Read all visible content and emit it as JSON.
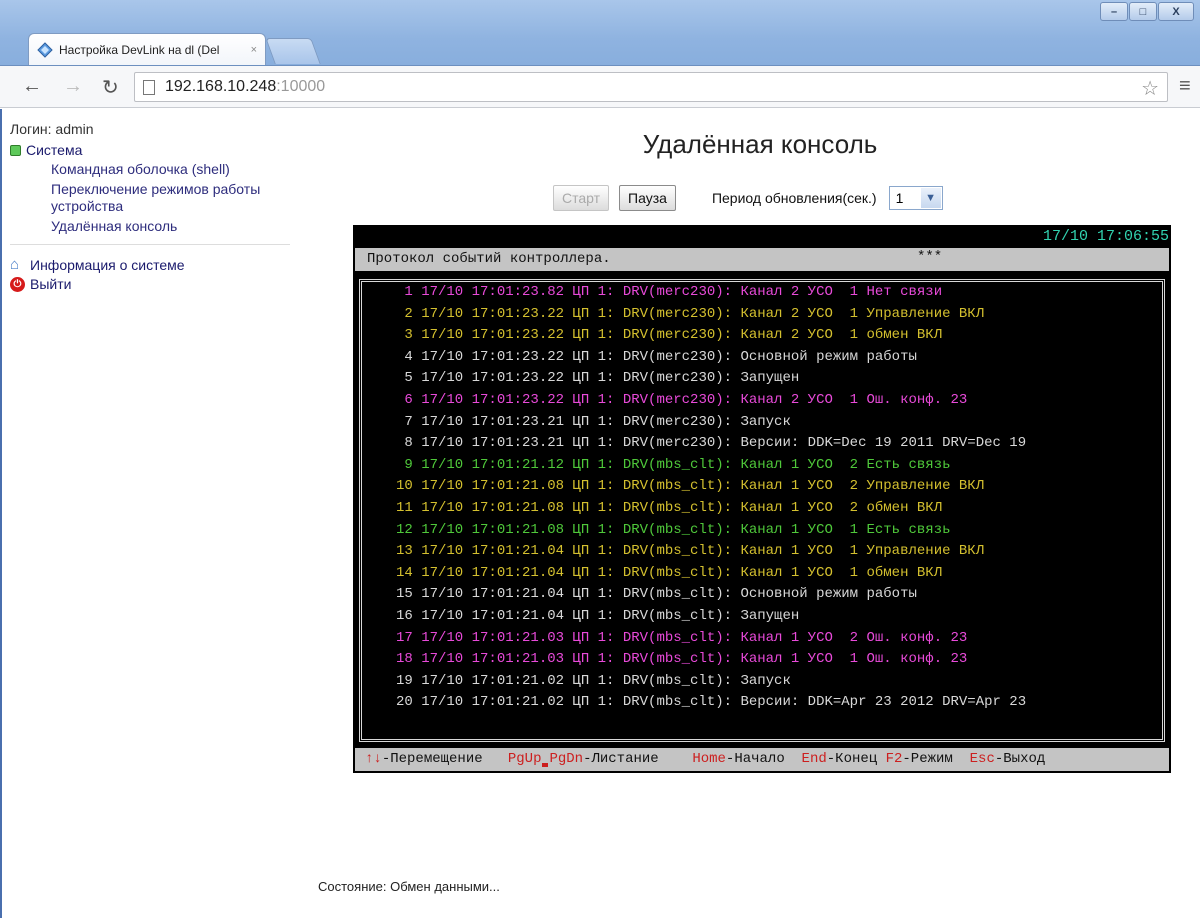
{
  "browser": {
    "tab_title": "Настройка DevLink на dl (Del",
    "tab_close": "×",
    "url_host": "192.168.10.248",
    "url_port": ":10000"
  },
  "window_buttons": {
    "minimize": "–",
    "maximize": "□",
    "close": "X"
  },
  "sidebar": {
    "login": "Логин: admin",
    "system": "Система",
    "system_items": [
      "Командная оболочка (shell)",
      "Переключение режимов работы устройства",
      "Удалённая консоль"
    ],
    "info": "Информация о системе",
    "logout": "Выйти"
  },
  "page": {
    "title": "Удалённая консоль"
  },
  "controls": {
    "start": "Старт",
    "pause": "Пауза",
    "period_label": "Период обновления(сек.)",
    "period_value": "1"
  },
  "console": {
    "clock": "17/10 17:06:55",
    "header_title": "Протокол событий контроллера.",
    "header_stars": "***",
    "colors": {
      "magenta": "#e84ad9",
      "yellow": "#d4c02f",
      "white": "#d8d8d8",
      "green": "#4fc83a",
      "key_red": "#cc1f1f",
      "clock": "#32d3b0"
    },
    "rows": [
      {
        "text": " 1 17/10 17:01:23.82 ЦП 1: DRV(merc230): Канал 2 УСО  1 Нет связи",
        "color": "m"
      },
      {
        "text": " 2 17/10 17:01:23.22 ЦП 1: DRV(merc230): Канал 2 УСО  1 Управление ВКЛ",
        "color": "y"
      },
      {
        "text": " 3 17/10 17:01:23.22 ЦП 1: DRV(merc230): Канал 2 УСО  1 обмен ВКЛ",
        "color": "y"
      },
      {
        "text": " 4 17/10 17:01:23.22 ЦП 1: DRV(merc230): Основной режим работы",
        "color": "w"
      },
      {
        "text": " 5 17/10 17:01:23.22 ЦП 1: DRV(merc230): Запущен",
        "color": "w"
      },
      {
        "text": " 6 17/10 17:01:23.22 ЦП 1: DRV(merc230): Канал 2 УСО  1 Ош. конф. 23",
        "color": "m"
      },
      {
        "text": " 7 17/10 17:01:23.21 ЦП 1: DRV(merc230): Запуск",
        "color": "w"
      },
      {
        "text": " 8 17/10 17:01:23.21 ЦП 1: DRV(merc230): Версии: DDK=Dec 19 2011 DRV=Dec 19",
        "color": "w"
      },
      {
        "text": " 9 17/10 17:01:21.12 ЦП 1: DRV(mbs_clt): Канал 1 УСО  2 Есть связь",
        "color": "g"
      },
      {
        "text": "10 17/10 17:01:21.08 ЦП 1: DRV(mbs_clt): Канал 1 УСО  2 Управление ВКЛ",
        "color": "y"
      },
      {
        "text": "11 17/10 17:01:21.08 ЦП 1: DRV(mbs_clt): Канал 1 УСО  2 обмен ВКЛ",
        "color": "y"
      },
      {
        "text": "12 17/10 17:01:21.08 ЦП 1: DRV(mbs_clt): Канал 1 УСО  1 Есть связь",
        "color": "g"
      },
      {
        "text": "13 17/10 17:01:21.04 ЦП 1: DRV(mbs_clt): Канал 1 УСО  1 Управление ВКЛ",
        "color": "y"
      },
      {
        "text": "14 17/10 17:01:21.04 ЦП 1: DRV(mbs_clt): Канал 1 УСО  1 обмен ВКЛ",
        "color": "y"
      },
      {
        "text": "15 17/10 17:01:21.04 ЦП 1: DRV(mbs_clt): Основной режим работы",
        "color": "w"
      },
      {
        "text": "16 17/10 17:01:21.04 ЦП 1: DRV(mbs_clt): Запущен",
        "color": "w"
      },
      {
        "text": "17 17/10 17:01:21.03 ЦП 1: DRV(mbs_clt): Канал 1 УСО  2 Ош. конф. 23",
        "color": "m"
      },
      {
        "text": "18 17/10 17:01:21.03 ЦП 1: DRV(mbs_clt): Канал 1 УСО  1 Ош. конф. 23",
        "color": "m"
      },
      {
        "text": "19 17/10 17:01:21.02 ЦП 1: DRV(mbs_clt): Запуск",
        "color": "w"
      },
      {
        "text": "20 17/10 17:01:21.02 ЦП 1: DRV(mbs_clt): Версии: DDK=Apr 23 2012 DRV=Apr 23",
        "color": "w"
      }
    ],
    "footer": {
      "arrows_key": "↑↓",
      "arrows_label": "-Перемещение",
      "pgup_key": "PgUp",
      "pgdn_key": "PgDn",
      "pg_label": "-Листание",
      "home_key": "Home",
      "home_label": "-Начало",
      "end_key": "End",
      "end_label": "-Конец",
      "f2_key": "F2",
      "f2_label": "-Режим",
      "esc_key": "Esc",
      "esc_label": "-Выход"
    }
  },
  "status": "Состояние: Обмен данными..."
}
